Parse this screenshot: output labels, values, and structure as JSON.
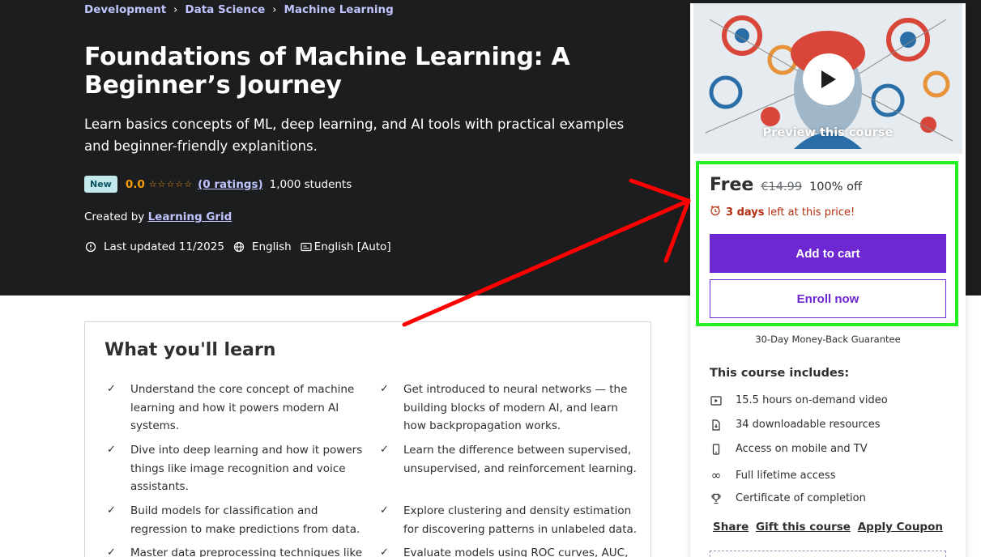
{
  "breadcrumb": [
    "Development",
    "Data Science",
    "Machine Learning"
  ],
  "course": {
    "title": "Foundations of Machine Learning: A Beginner’s Journey",
    "subtitle": "Learn basics concepts of ML, deep learning, and AI tools with practical examples and beginner-friendly explanitions.",
    "badge": "New",
    "rating": "0.0",
    "ratings_count": "(0 ratings)",
    "students": "1,000 students",
    "created_by_label": "Created by",
    "author": "Learning Grid",
    "last_updated": "Last updated 11/2025",
    "language": "English",
    "captions": "English [Auto]"
  },
  "learn": {
    "title": "What you'll learn",
    "items": [
      "Understand the core concept of machine learning and how it powers modern AI systems.",
      "Get introduced to neural networks — the building blocks of modern AI, and learn how backpropagation works.",
      "Dive into deep learning and how it powers things like image recognition and voice assistants.",
      "Learn the difference between supervised, unsupervised, and reinforcement learning.",
      "Build models for classification and regression to make predictions from data.",
      "Explore clustering and density estimation for discovering patterns in unlabeled data.",
      "Master data preprocessing techniques like",
      "Evaluate models using ROC curves, AUC, and"
    ]
  },
  "sidebar": {
    "preview_label": "Preview this course",
    "price_now": "Free",
    "price_old": "€14.99",
    "discount": "100% off",
    "timer_days": "3 days",
    "timer_rest": "left at this price!",
    "add_to_cart": "Add to cart",
    "enroll_now": "Enroll now",
    "guarantee": "30-Day Money-Back Guarantee",
    "includes_title": "This course includes:",
    "includes": [
      {
        "icon": "video-icon",
        "text": "15.5 hours on-demand video"
      },
      {
        "icon": "file-download-icon",
        "text": "34 downloadable resources"
      },
      {
        "icon": "mobile-icon",
        "text": "Access on mobile and TV"
      },
      {
        "icon": "infinity-icon",
        "text": "Full lifetime access"
      },
      {
        "icon": "trophy-icon",
        "text": "Certificate of completion"
      }
    ],
    "share": "Share",
    "gift": "Gift this course",
    "coupon": "Apply Coupon"
  },
  "colors": {
    "hero_bg": "#1c1d1f",
    "accent_purple": "#6d28d2",
    "link_lavender": "#c0c4fc",
    "star_orange": "#f69c08",
    "timer_red": "#b32d0f",
    "highlight_green": "#22ee22",
    "arrow_red": "#ff0000"
  }
}
